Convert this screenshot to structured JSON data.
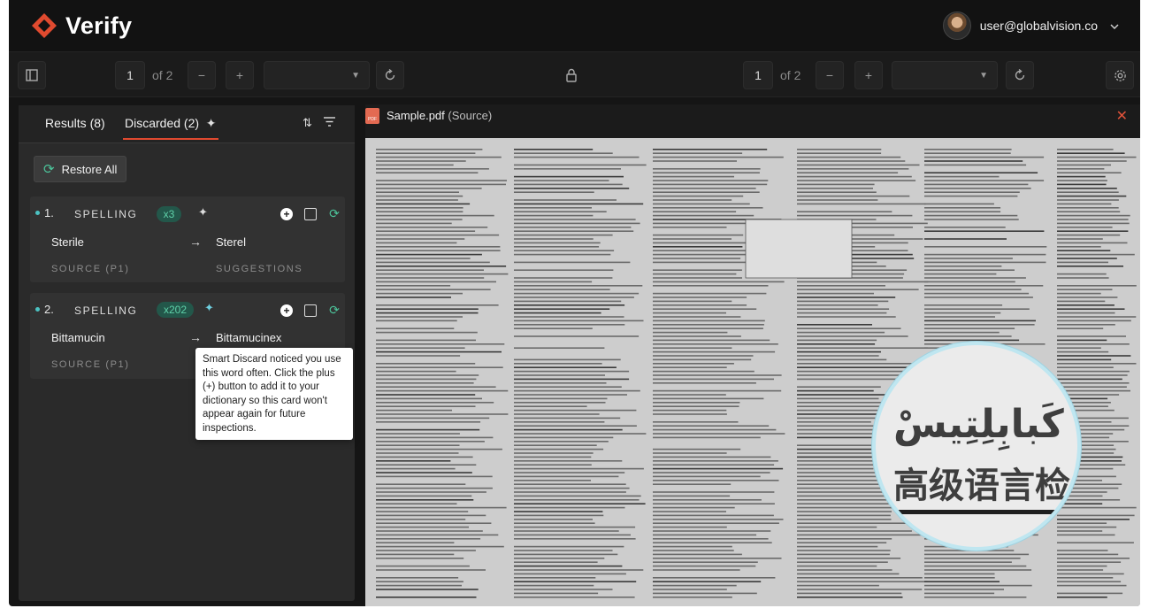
{
  "app": {
    "name": "Verify",
    "brand_color": "#e04a2f",
    "accent_teal": "#4cc39a"
  },
  "user": {
    "email": "user@globalvision.co"
  },
  "toolbar": {
    "left": {
      "page": "1",
      "of": "of 2",
      "minus": "−",
      "plus": "+"
    },
    "right": {
      "page": "1",
      "of": "of 2",
      "minus": "−",
      "plus": "+"
    }
  },
  "tabs": {
    "results": "Results (8)",
    "discarded": "Discarded (2)"
  },
  "restore_label": "Restore All",
  "cards": [
    {
      "index": "1.",
      "type": "SPELLING",
      "count": "x3",
      "word": "Sterile",
      "suggestion": "Sterel",
      "source": "SOURCE (P1)",
      "suggestions_label": "SUGGESTIONS"
    },
    {
      "index": "2.",
      "type": "SPELLING",
      "count": "x202",
      "word": "Bittamucin",
      "suggestion": "Bittamucinex",
      "source": "SOURCE (P1)"
    }
  ],
  "tooltip": "Smart Discard noticed you use this word often. Click the plus (+) button to add it to your dictionary so this card won't appear again for future inspections.",
  "document": {
    "filename": "Sample.pdf",
    "label": "(Source)"
  },
  "magnifier": {
    "line1": "ـن كَبابِلِتِيسْ",
    "line2": "高级语言检"
  }
}
